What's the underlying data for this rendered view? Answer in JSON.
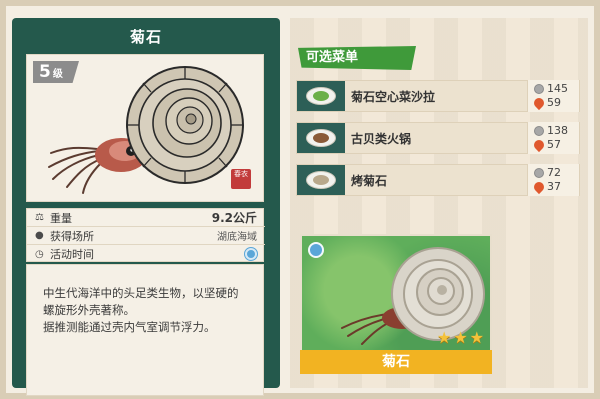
{
  "left": {
    "title": "菊石",
    "level": {
      "number": "5",
      "unit": "级"
    },
    "stamp_text": "春衣",
    "info": {
      "weight_label": "重量",
      "weight_value": "9.2公斤",
      "location_label": "获得场所",
      "location_value": "湖底海域",
      "time_label": "活动时间"
    },
    "description": [
      "中生代海洋中的头足类生物，以坚硬的螺旋形外壳著称。",
      "据推测能通过壳内气室调节浮力。"
    ]
  },
  "right": {
    "section_title": "可选菜单",
    "menu": [
      {
        "name": "菊石空心菜沙拉",
        "price": "145",
        "value": "59",
        "dish": "salad"
      },
      {
        "name": "古贝类火锅",
        "price": "138",
        "value": "57",
        "dish": "pot"
      },
      {
        "name": "烤菊石",
        "price": "72",
        "value": "37",
        "dish": "roast"
      }
    ],
    "card": {
      "name": "菊石",
      "stars": 3
    }
  },
  "colors": {
    "panel_green": "#24594c",
    "banner_green": "#3f9a3a",
    "card_bar": "#f2b322",
    "star": "#f4c23a"
  }
}
